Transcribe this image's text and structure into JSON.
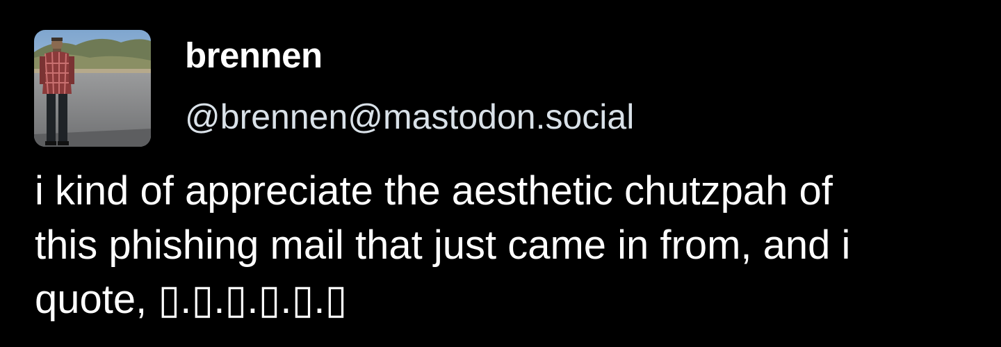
{
  "author": {
    "display_name": "brennen",
    "handle": "@brennen@mastodon.social",
    "avatar_icon": "avatar-photo-icon"
  },
  "post": {
    "lines": [
      "i kind of appreciate the aesthetic chutzpah of",
      "this phishing mail that just came in from, and i",
      "quote, ▯.▯.▯.▯.▯.▯"
    ]
  },
  "colors": {
    "background": "#000000",
    "text": "#ffffff",
    "handle": "#d9e1e8"
  }
}
